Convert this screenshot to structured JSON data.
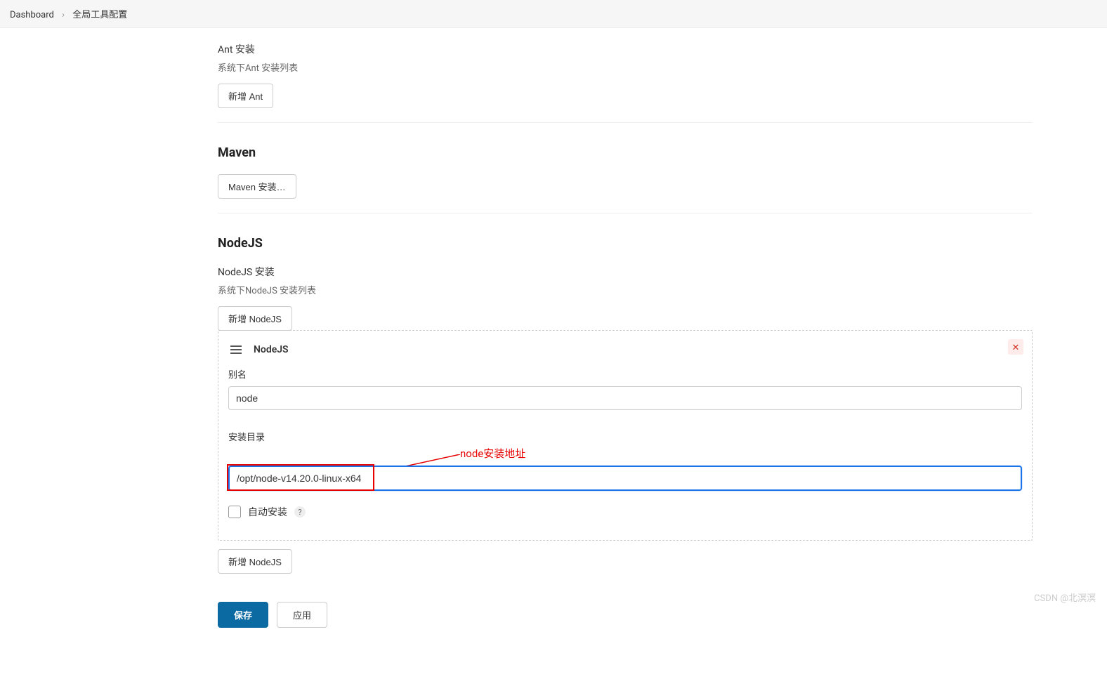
{
  "breadcrumb": {
    "dashboard": "Dashboard",
    "current": "全局工具配置"
  },
  "ant": {
    "title": "Ant 安装",
    "subtitle": "系统下Ant 安装列表",
    "add_button": "新增 Ant"
  },
  "maven": {
    "heading": "Maven",
    "install_button": "Maven 安装…"
  },
  "nodejs": {
    "heading": "NodeJS",
    "title": "NodeJS 安装",
    "subtitle": "系统下NodeJS 安装列表",
    "add_button_top": "新增 NodeJS",
    "add_button_bottom": "新增 NodeJS",
    "panel": {
      "title": "NodeJS",
      "alias_label": "别名",
      "alias_value": "node",
      "dir_label": "安装目录",
      "dir_value": "/opt/node-v14.20.0-linux-x64",
      "auto_install_label": "自动安装"
    }
  },
  "annotation": {
    "text": "node安装地址"
  },
  "footer": {
    "save": "保存",
    "apply": "应用"
  },
  "watermark": "CSDN @北溟溟"
}
